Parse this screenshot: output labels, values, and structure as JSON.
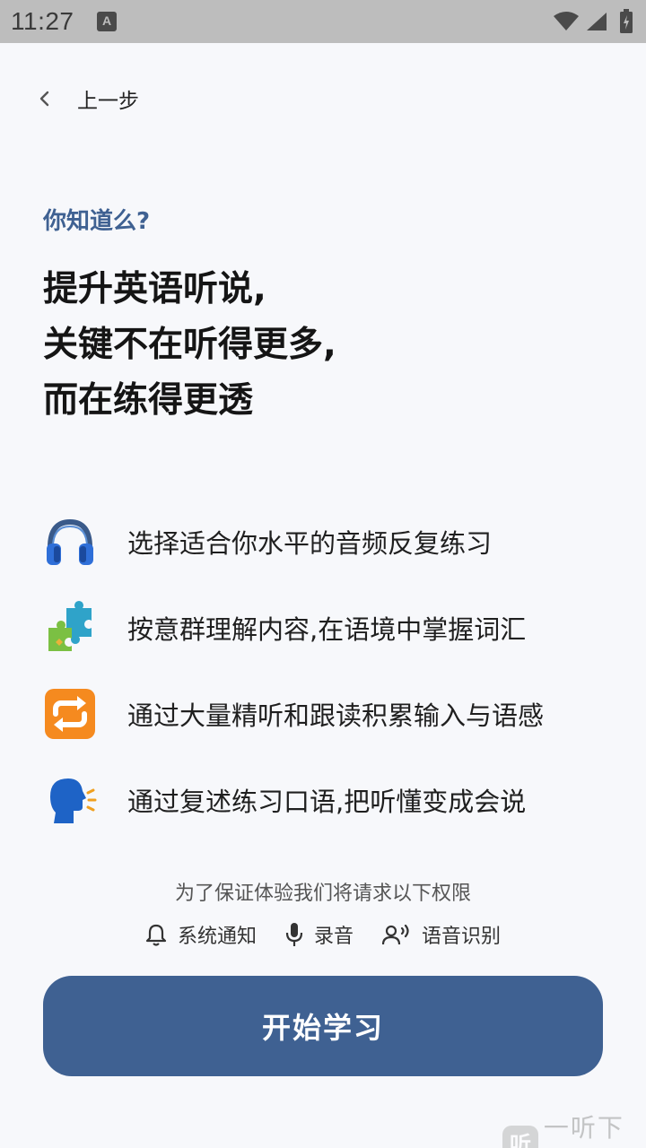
{
  "status_bar": {
    "time": "11:27",
    "notification_icon": "keyboard-a-icon"
  },
  "nav": {
    "back_label": "上一步"
  },
  "intro": {
    "eyebrow": "你知道么?",
    "headline_lines": [
      "提升英语听说,",
      "关键不在听得更多,",
      "而在练得更透"
    ]
  },
  "features": [
    {
      "icon": "headphones-icon",
      "text": "选择适合你水平的音频反复练习"
    },
    {
      "icon": "puzzle-icon",
      "text": "按意群理解内容,在语境中掌握词汇"
    },
    {
      "icon": "repeat-icon",
      "text": "通过大量精听和跟读积累输入与语感"
    },
    {
      "icon": "speaking-head-icon",
      "text": "通过复述练习口语,把听懂变成会说"
    }
  ],
  "permissions": {
    "note": "为了保证体验我们将请求以下权限",
    "items": [
      {
        "icon": "bell-icon",
        "label": "系统通知"
      },
      {
        "icon": "microphone-icon",
        "label": "录音"
      },
      {
        "icon": "voice-recognition-icon",
        "label": "语音识别"
      }
    ]
  },
  "cta": {
    "label": "开始学习"
  },
  "watermark": {
    "logo": "听",
    "text": "一听下载"
  },
  "colors": {
    "accent": "#3f6192",
    "background": "#f7f8fb"
  }
}
